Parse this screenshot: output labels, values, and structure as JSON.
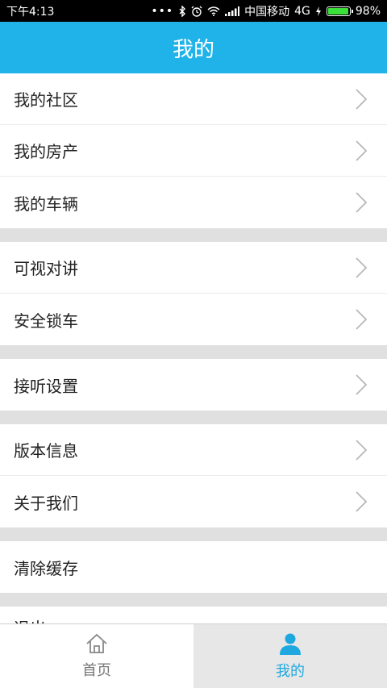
{
  "status_bar": {
    "time": "下午4:13",
    "carrier": "中国移动",
    "network": "4G",
    "battery": "98%",
    "battery_level": 0.98
  },
  "header": {
    "title": "我的"
  },
  "menu_groups": [
    {
      "items": [
        {
          "label": "我的社区"
        },
        {
          "label": "我的房产"
        },
        {
          "label": "我的车辆"
        }
      ]
    },
    {
      "items": [
        {
          "label": "可视对讲"
        },
        {
          "label": "安全锁车"
        }
      ]
    },
    {
      "items": [
        {
          "label": "接听设置"
        }
      ]
    },
    {
      "items": [
        {
          "label": "版本信息"
        },
        {
          "label": "关于我们"
        }
      ]
    },
    {
      "items": [
        {
          "label": "清除缓存"
        }
      ]
    }
  ],
  "partial_item": {
    "label": "退出"
  },
  "tabbar": {
    "tabs": [
      {
        "label": "首页",
        "icon": "home-icon",
        "active": false
      },
      {
        "label": "我的",
        "icon": "user-icon",
        "active": true
      }
    ],
    "active_color": "#1fa8e0"
  },
  "colors": {
    "accent": "#1fb3ea",
    "divider": "#e0e0e0"
  }
}
